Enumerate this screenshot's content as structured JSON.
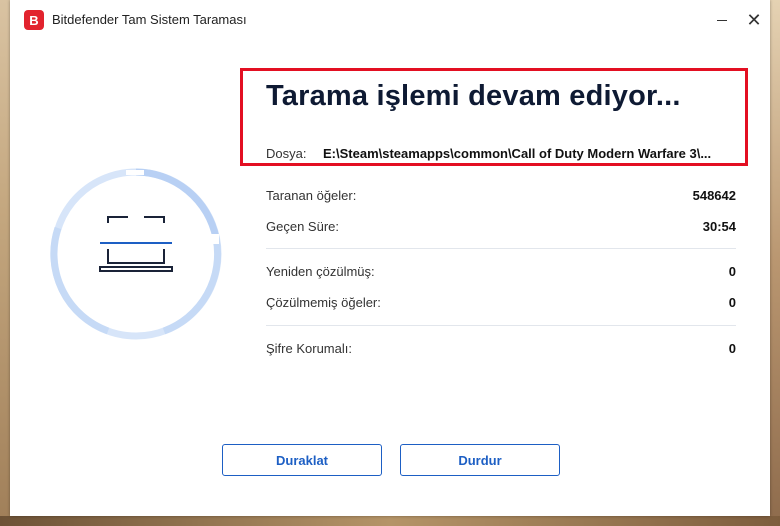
{
  "window": {
    "logo_letter": "B",
    "title": "Bitdefender Tam Sistem Taraması",
    "close_glyph": "✕"
  },
  "scan": {
    "heading": "Tarama işlemi devam ediyor...",
    "file_label": "Dosya:",
    "file_path": "E:\\Steam\\steamapps\\common\\Call of Duty Modern Warfare 3\\..."
  },
  "stats": [
    {
      "label": "Taranan öğeler:",
      "value": "548642"
    },
    {
      "label": "Geçen Süre:",
      "value": "30:54"
    },
    {
      "label": "Yeniden çözülmüş:",
      "value": "0"
    },
    {
      "label": "Çözülmemiş öğeler:",
      "value": "0"
    },
    {
      "label": "Şifre Korumalı:",
      "value": "0"
    }
  ],
  "buttons": {
    "pause": "Duraklat",
    "stop": "Durdur"
  },
  "colors": {
    "brand": "#e2232e",
    "accent": "#1d5fc4",
    "highlight_border": "#e30f22",
    "ring": "#c9dcf7"
  },
  "icons": {
    "center": "laptop-scan-icon"
  }
}
